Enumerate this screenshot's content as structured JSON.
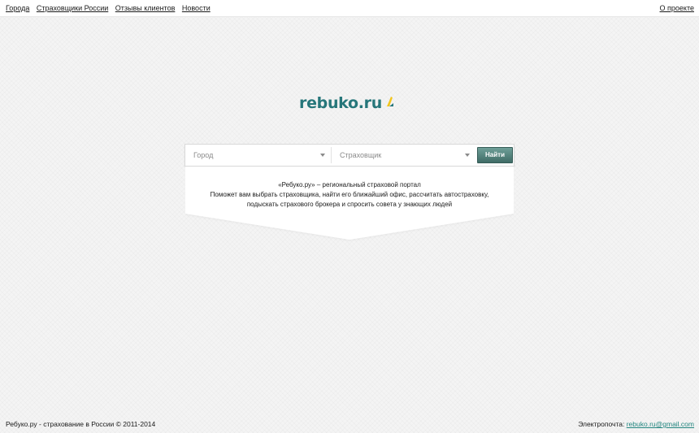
{
  "nav": {
    "items": [
      {
        "label": "Города"
      },
      {
        "label": "Страховщики России"
      },
      {
        "label": "Отзывы клиентов"
      },
      {
        "label": "Новости"
      }
    ],
    "about": "О проекте"
  },
  "logo": {
    "text": "rebuko.ru",
    "color": "#26767a",
    "mark_colors": [
      "#f2c51c",
      "#26767a"
    ]
  },
  "search": {
    "city": "Город",
    "insurer": "Страховщик",
    "button": "Найти"
  },
  "intro": {
    "line1": "«Ребуко.ру» – региональный страховой портал",
    "line2": "Поможет вам выбрать страховщика, найти его ближайший офис, рассчитать автостраховку,",
    "line3": "подыскать страхового брокера и спросить совета у знающих людей"
  },
  "footer": {
    "copyright": "Ребуко.ру - страхование в России © 2011-2014",
    "email_label": "Электропочта:",
    "email": "rebuko.ru@gmail.com"
  }
}
